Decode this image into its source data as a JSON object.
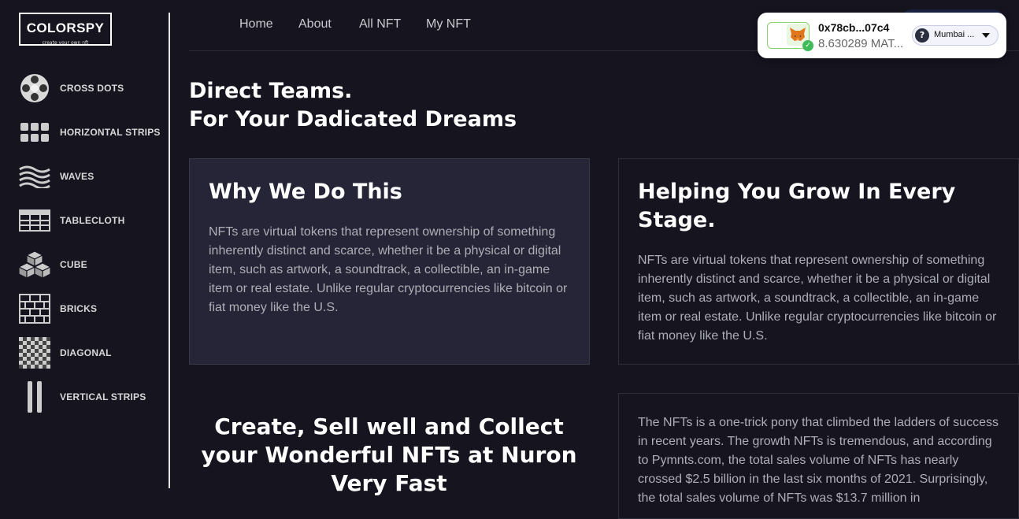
{
  "logo": {
    "title": "COLORSPY",
    "tagline": "create your own nft"
  },
  "sidebar": {
    "items": [
      {
        "label": "CROSS DOTS",
        "icon": "cross-dots-icon"
      },
      {
        "label": "HORIZONTAL STRIPS",
        "icon": "horizontal-strips-icon"
      },
      {
        "label": "WAVES",
        "icon": "waves-icon"
      },
      {
        "label": "TABLECLOTH",
        "icon": "tablecloth-icon"
      },
      {
        "label": "CUBE",
        "icon": "cube-icon"
      },
      {
        "label": "BRICKS",
        "icon": "bricks-icon"
      },
      {
        "label": "DIAGONAL",
        "icon": "diagonal-icon"
      },
      {
        "label": "VERTICAL STRIPS",
        "icon": "vertical-strips-icon"
      }
    ]
  },
  "nav": {
    "links": [
      "Home",
      "About",
      "All NFT",
      "My NFT"
    ]
  },
  "wallet": {
    "address": "0x78cb...07c4",
    "balance": "8.630289 MAT...",
    "network": "Mumbai ...",
    "fox_icon": "metamask-fox-icon"
  },
  "hero": {
    "line1": "Direct Teams.",
    "line2": "For Your Dadicated Dreams"
  },
  "cards": [
    {
      "title": "Why We Do This",
      "body": "NFTs are virtual tokens that represent ownership of something inherently distinct and scarce, whether it be a physical or digital item, such as artwork, a soundtrack, a collectible, an in-game item or real estate. Unlike regular cryptocurrencies like bitcoin or fiat money like the U.S."
    },
    {
      "title": "Helping You Grow In Every Stage.",
      "body": "NFTs are virtual tokens that represent ownership of something inherently distinct and scarce, whether it be a physical or digital item, such as artwork, a soundtrack, a collectible, an in-game item or real estate. Unlike regular cryptocurrencies like bitcoin or fiat money like the U.S."
    },
    {
      "title": "",
      "body": "The NFTs is a one-trick pony that climbed the ladders of success in recent years. The growth NFTs is tremendous, and according to Pymnts.com, the total sales volume of NFTs has nearly crossed $2.5 billion in the last six months of 2021. Surprisingly, the total sales volume of NFTs was $13.7 million in"
    }
  ],
  "cta": {
    "text": "Create, Sell well and Collect your Wonderful NFTs at Nuron Very Fast"
  },
  "colors": {
    "background": "#15141f",
    "card_dark": "#262537",
    "text_muted": "#aeaeb6"
  }
}
